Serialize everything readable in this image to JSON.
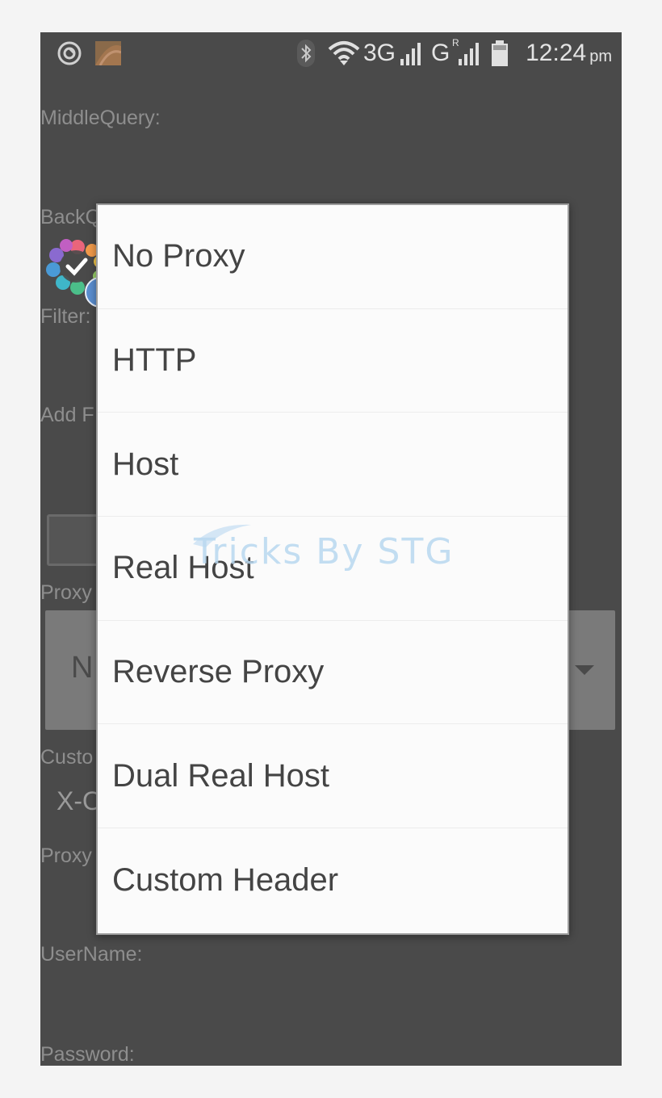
{
  "status_bar": {
    "time": "12:24",
    "ampm": "pm",
    "network_1": "3G",
    "network_2": "G",
    "roaming_mark": "R",
    "icons": [
      "circle-notification-icon",
      "image-thumbnail-icon",
      "bluetooth-icon",
      "wifi-icon",
      "signal-icon",
      "battery-icon"
    ]
  },
  "form": {
    "middle_query_label": "MiddleQuery:",
    "back_query_label": "BackQ",
    "filter_label": "Filter:",
    "add_label": "Add F",
    "proxy_label": "Proxy",
    "proxy_type_value": "N",
    "custom_label": "Custo",
    "custom_value": "X-O",
    "proxy2_label": "Proxy",
    "username_label": "UserName:",
    "password_label": "Password:"
  },
  "dialog": {
    "options": [
      "No Proxy",
      "HTTP",
      "Host",
      "Real Host",
      "Reverse Proxy",
      "Dual Real Host",
      "Custom Header"
    ]
  },
  "watermark": {
    "text": "Tricks By STG"
  },
  "colors": {
    "background": "#4a4a4a",
    "dialog": "#fbfbfb",
    "watermark": "#b9d8f0",
    "info_badge": "#5b8fd1"
  }
}
